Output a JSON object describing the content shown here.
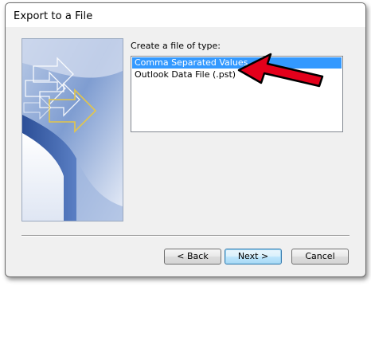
{
  "window": {
    "title": "Export to a File"
  },
  "main": {
    "list_label": "Create a file of type:",
    "file_types": [
      {
        "label": "Comma Separated Values",
        "selected": true
      },
      {
        "label": "Outlook Data File (.pst)",
        "selected": false
      }
    ]
  },
  "buttons": {
    "back": "< Back",
    "next": "Next >",
    "cancel": "Cancel"
  },
  "colors": {
    "selection": "#3399ff",
    "annotation_arrow": "#e3001b"
  },
  "icons": {
    "banner": "export-arrows-illustration",
    "annotation": "red-arrow-annotation"
  }
}
